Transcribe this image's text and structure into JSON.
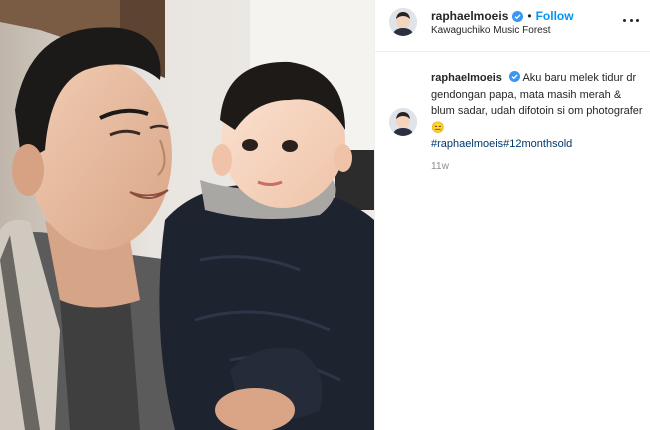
{
  "post": {
    "username": "raphaelmoeis",
    "verified": true,
    "follow_label": "Follow",
    "separator": "•",
    "location": "Kawaguchiko Music Forest",
    "more_icon": "more-options-icon"
  },
  "caption": {
    "username": "raphaelmoeis",
    "text": "Aku baru melek tidur dr gendongan papa, mata masih merah & blum sadar, udah difotoin si om photografer 😑",
    "hashtags": [
      "#raphaelmoeis",
      "#12monthsold"
    ],
    "time": "11w"
  },
  "colors": {
    "link_blue": "#0095f6",
    "hashtag_blue": "#00376b",
    "muted": "#8e8e8e"
  }
}
